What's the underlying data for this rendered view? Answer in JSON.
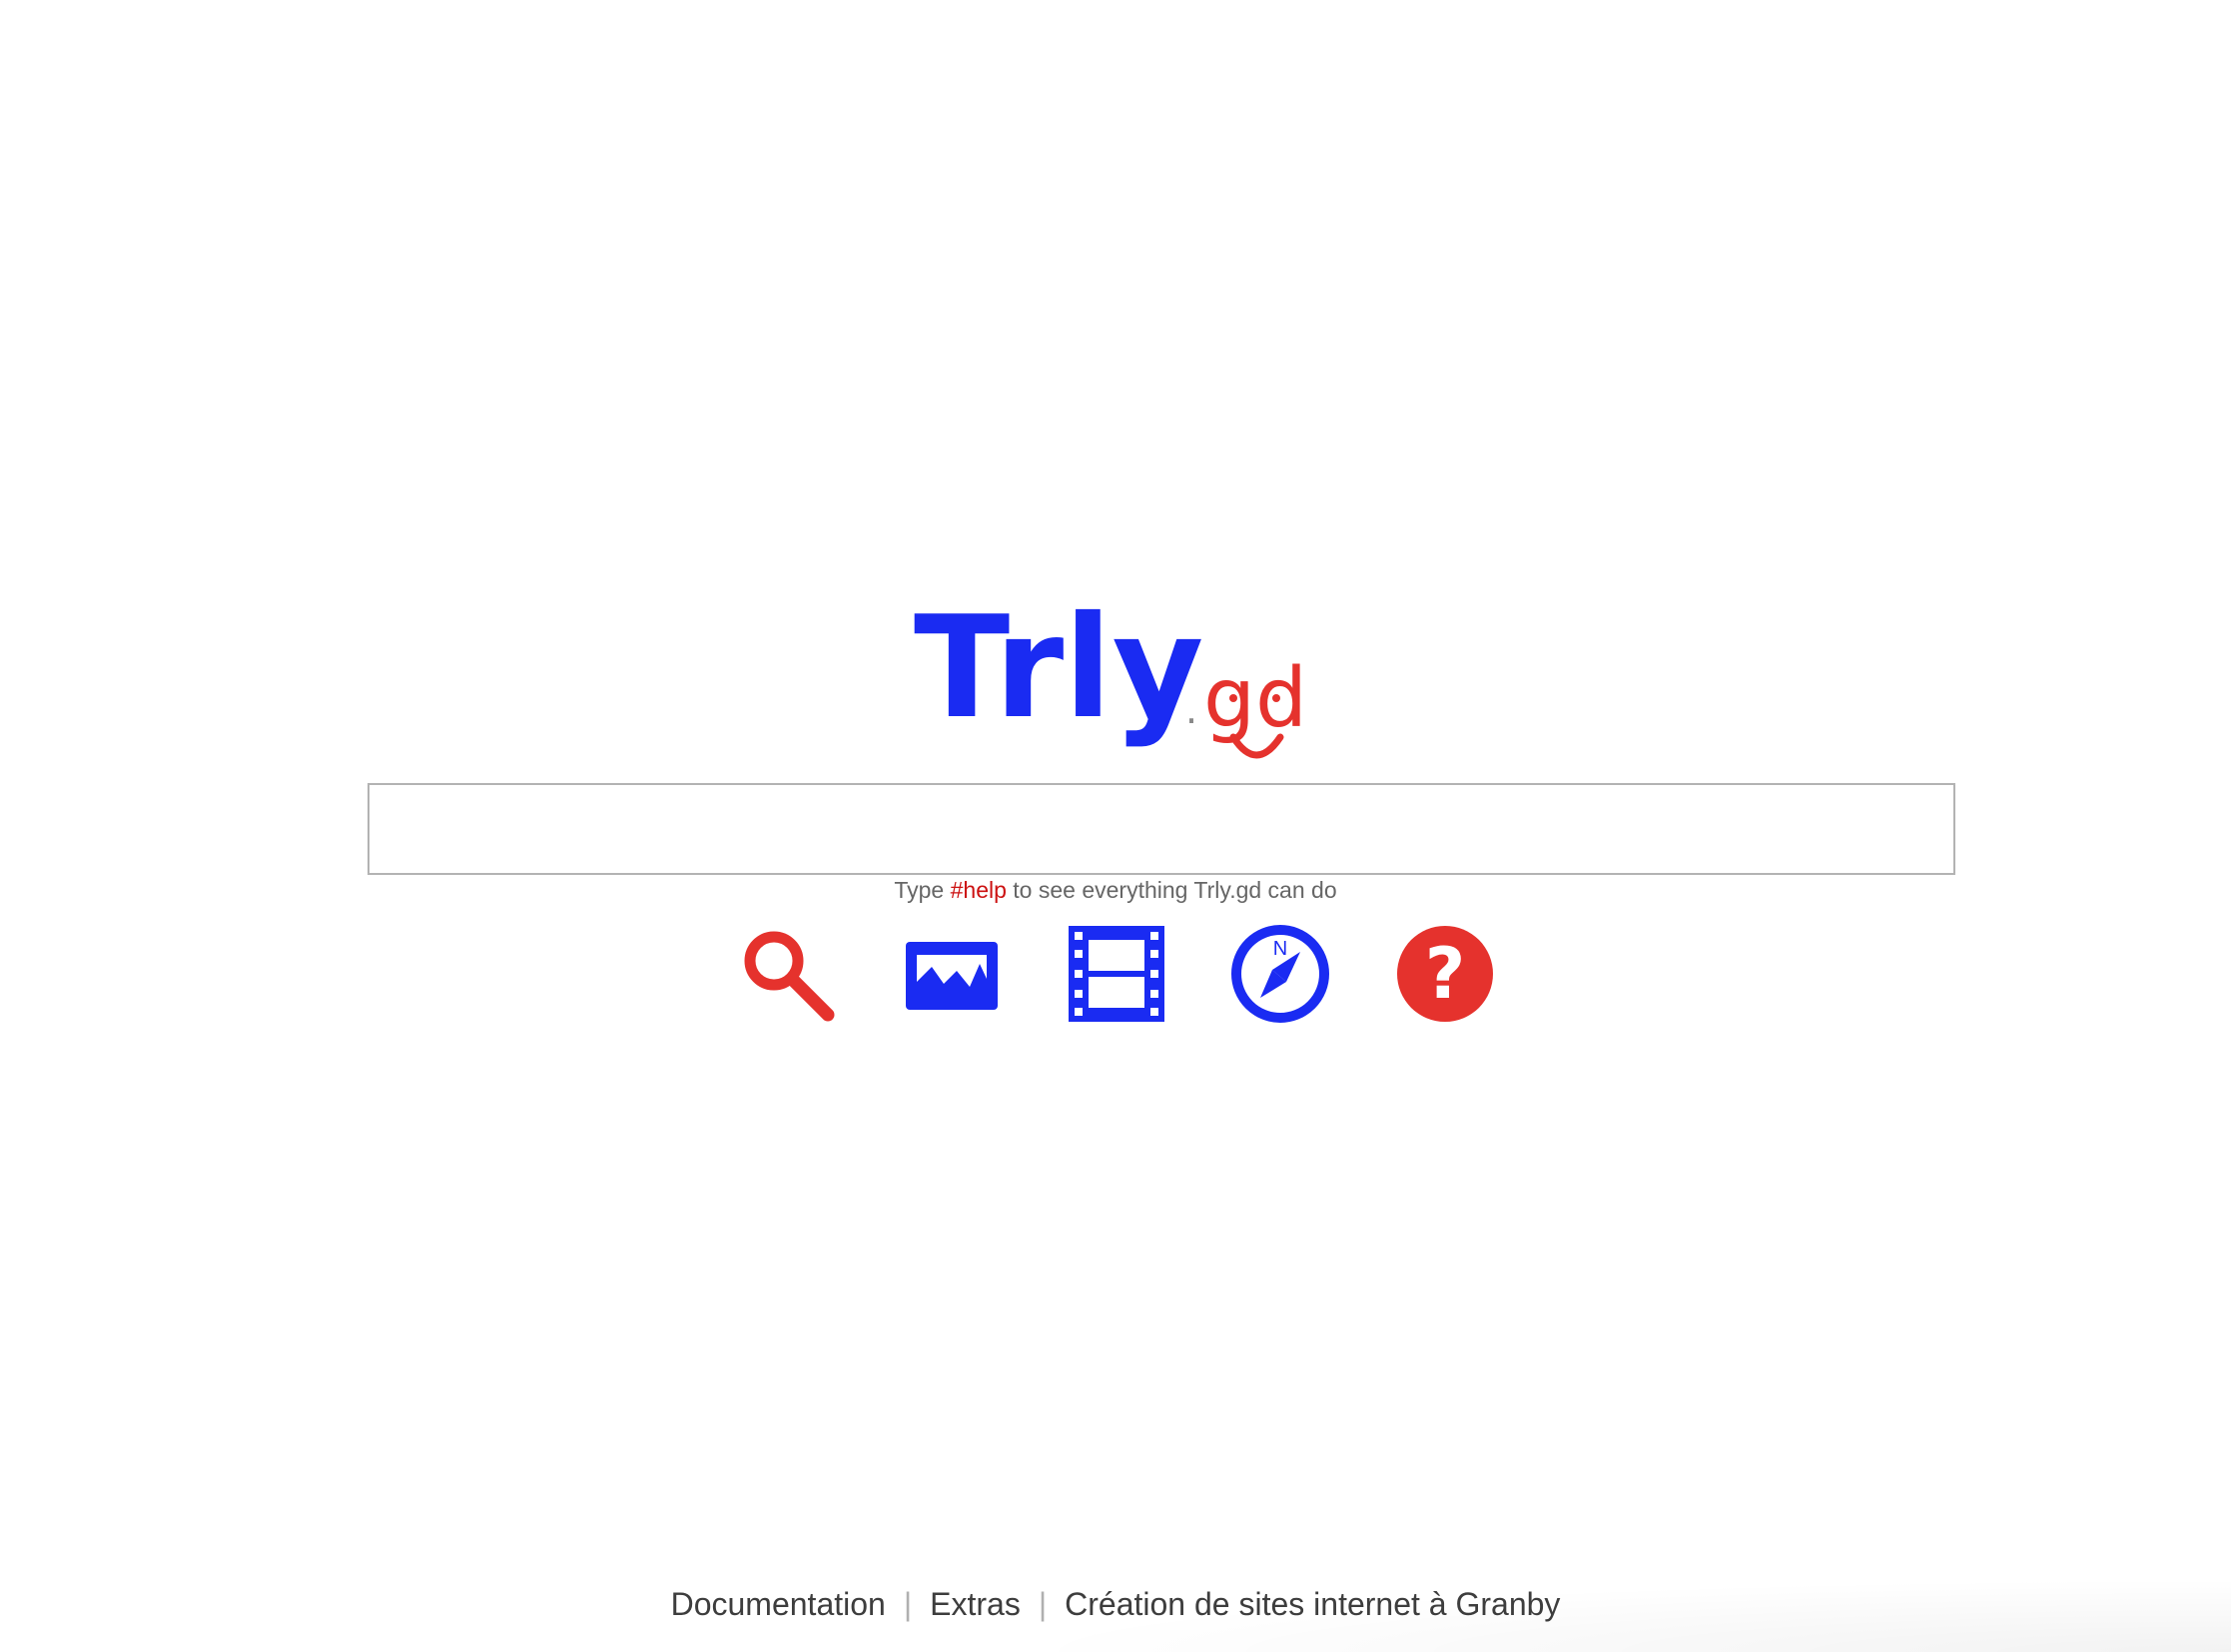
{
  "logo": {
    "main_text": "Trly",
    "dot_text": ".",
    "suffix_text": "gd",
    "main_color": "#1a2bf2",
    "suffix_color": "#e5322d",
    "dot_color": "#888888"
  },
  "search": {
    "value": "",
    "placeholder": ""
  },
  "hint": {
    "prefix": "Type ",
    "keyword": "#help",
    "suffix": " to see everything Trly.gd can do"
  },
  "toolbar": {
    "buttons": [
      {
        "icon": "search-icon",
        "color": "#e5322d"
      },
      {
        "icon": "image-icon",
        "color": "#1a2bf2"
      },
      {
        "icon": "video-icon",
        "color": "#1a2bf2"
      },
      {
        "icon": "compass-icon",
        "color": "#1a2bf2",
        "glyph": "N"
      },
      {
        "icon": "help-icon",
        "color": "#e5322d",
        "glyph": "?"
      }
    ]
  },
  "footer": {
    "links": [
      {
        "label": "Documentation"
      },
      {
        "label": "Extras"
      },
      {
        "label": "Création de sites internet à Granby"
      }
    ],
    "separator": "|"
  }
}
